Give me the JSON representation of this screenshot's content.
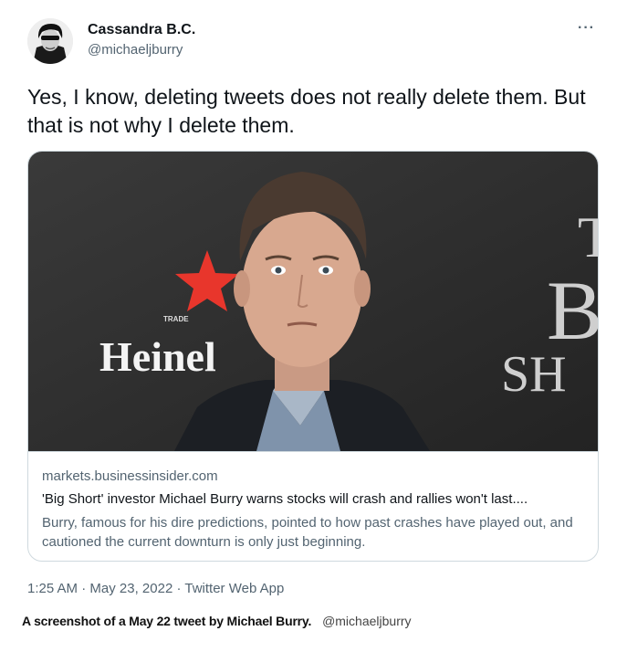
{
  "tweet": {
    "display_name": "Cassandra B.C.",
    "handle": "@michaeljburry",
    "more_icon": "more-horizontal-icon",
    "text": "Yes, I know, deleting tweets does not really delete them. But that is not why I delete them.",
    "card": {
      "image_sign": {
        "trade": "TRADE",
        "brand": "Heinel",
        "banner_lines": [
          "T",
          "B",
          "SH"
        ]
      },
      "domain": "markets.businessinsider.com",
      "title": "'Big Short' investor Michael Burry warns stocks will crash and rallies won't last....",
      "description": "Burry, famous for his dire predictions, pointed to how past crashes have played out, and cautioned the current downturn is only just beginning."
    },
    "meta": {
      "time": "1:25 AM",
      "date": "May 23, 2022",
      "source": "Twitter Web App"
    }
  },
  "caption": {
    "text": "A screenshot of a May 22 tweet by Michael Burry.",
    "credit": "@michaeljburry"
  },
  "colors": {
    "star_red": "#e8362c",
    "text_primary": "#0f1419",
    "text_secondary": "#536471",
    "card_border": "#cfd9de"
  }
}
